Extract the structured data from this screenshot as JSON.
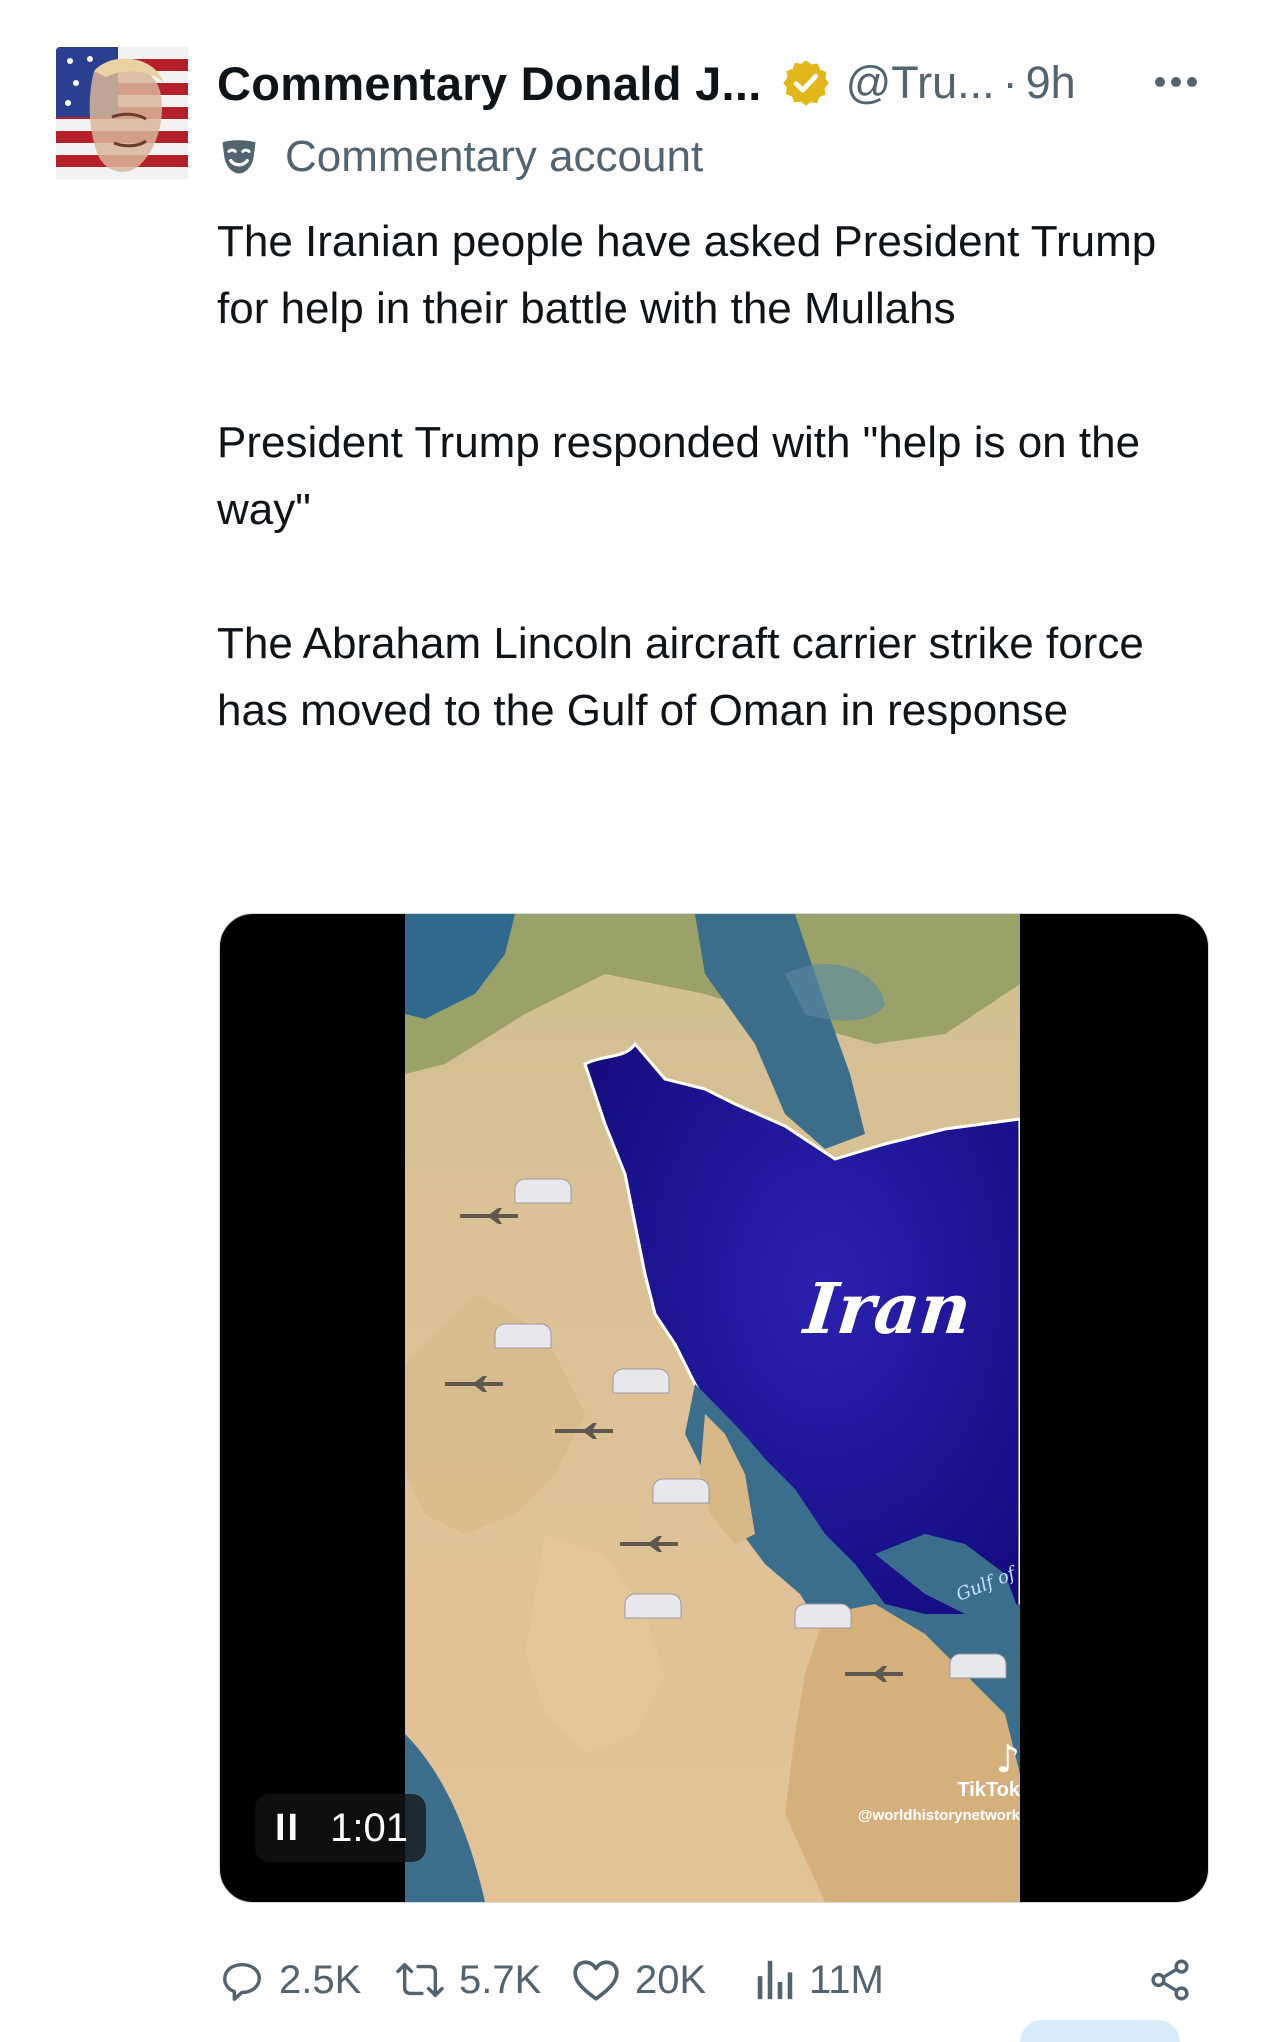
{
  "author": {
    "display_name": "Commentary Donald J...",
    "handle": "@Tru...",
    "separator": "·",
    "time": "9h",
    "label": "Commentary account"
  },
  "icons": {
    "verified": "verified-badge-icon",
    "label": "comedy-mask-icon",
    "more": "more-icon",
    "reply": "reply-icon",
    "repost": "repost-icon",
    "like": "like-icon",
    "views": "views-icon",
    "share": "share-icon",
    "pause": "pause-icon",
    "tiktok": "tiktok-logo-icon"
  },
  "tweet": {
    "paragraphs": [
      "The Iranian people have asked President Trump for help in their battle with the Mullahs",
      "President Trump responded with \"help is on the way\"",
      "The Abraham Lincoln aircraft carrier strike force has moved to the Gulf of Oman in response"
    ]
  },
  "media": {
    "map_label": "Iran",
    "gulf_label": "Gulf of",
    "watermark_brand": "TikTok",
    "watermark_user": "@worldhistorynetwork",
    "timer": "1:01",
    "pause_glyph": "II"
  },
  "actions": {
    "replies": "2.5K",
    "reposts": "5.7K",
    "likes": "20K",
    "views": "11M"
  },
  "colors": {
    "text": "#0f1419",
    "secondary": "#536471",
    "verified_gold": "#e2b719",
    "map_iran": "#1a1190",
    "map_sea": "#3b6e8c",
    "map_desert": "#d9b98a"
  }
}
